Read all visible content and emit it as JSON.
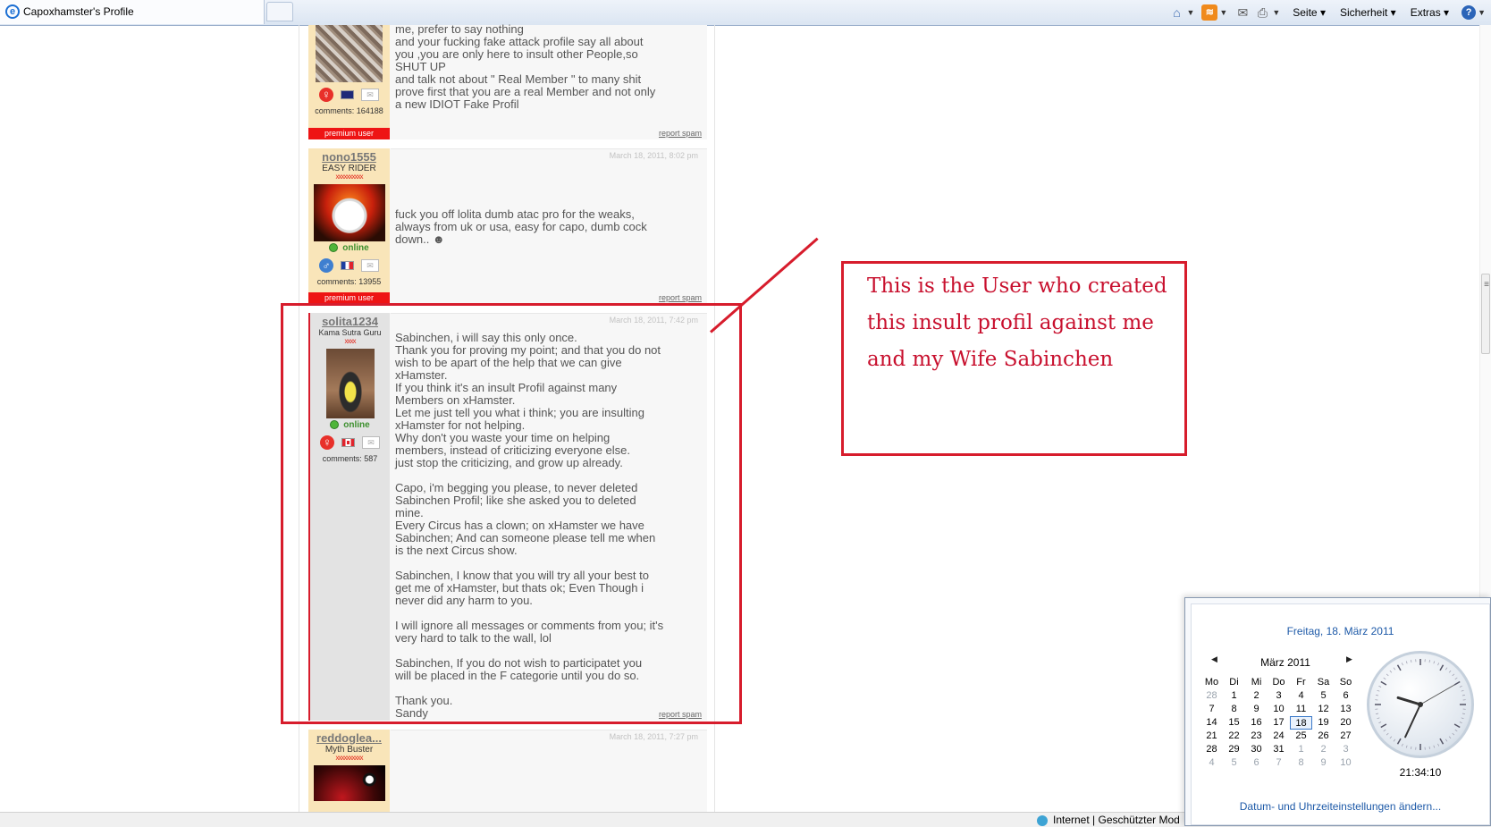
{
  "browser": {
    "tab_title": "Capoxhamster's Profile",
    "menus": [
      "Seite",
      "Sicherheit",
      "Extras"
    ]
  },
  "posts": [
    {
      "text": "me, prefer to say nothing\nand your fucking fake attack profile say all about\nyou ,you are only here to insult other People,so\nSHUT UP\nand talk not about \" Real Member \" to many shit\nprove first that you are a real Member and not only\na new IDIOT Fake Profil",
      "comments": "comments: 164188",
      "badge": "premium user",
      "report": "report spam"
    },
    {
      "username": "nono1555",
      "rank": "EASY RIDER",
      "stars": "xxxxxxxxxx",
      "status": "online",
      "date": "March 18, 2011, 8:02 pm",
      "text": "fuck you off lolita dumb atac pro for the weaks,\nalways from uk or usa, easy for capo, dumb cock\ndown.. ☻",
      "comments": "comments: 13955",
      "badge": "premium user",
      "report": "report spam"
    },
    {
      "username": "solita1234",
      "rank": "Kama Sutra Guru",
      "stars": "xxxx",
      "status": "online",
      "date": "March 18, 2011, 7:42 pm",
      "text": "Sabinchen, i will say this only once.\nThank you for proving my point; and that you do not\nwish to be apart of the help that we can give\nxHamster.\nIf you think it's an insult Profil against many\nMembers on xHamster.\nLet me just tell you what i think; you are insulting\nxHamster for not helping.\nWhy don't you waste your time on helping\nmembers, instead of criticizing everyone else.\njust stop the criticizing, and grow up already.\n\nCapo, i'm begging you please, to never deleted\nSabinchen Profil; like she asked you to deleted\nmine.\nEvery Circus has a clown; on xHamster we have\nSabinchen; And can someone please tell me when\nis the next Circus show.\n\nSabinchen, I know that you will try all your best to\nget me of xHamster, but thats ok; Even Though i\nnever did any harm to you.\n\nI will ignore all messages or comments from you; it's\nvery hard to talk to the wall, lol\n\nSabinchen, If you do not wish to participatet you\nwill be placed in the F categorie until you do so.\n\nThank you.\nSandy",
      "comments": "comments: 587",
      "report": "report spam"
    },
    {
      "username": "reddoglea...",
      "rank": "Myth Buster",
      "stars": "xxxxxxxxxx",
      "date": "March 18, 2011, 7:27 pm"
    }
  ],
  "annotation": {
    "text": "This is the User who created this insult profil against me and my Wife Sabinchen",
    "color": "#d71c2c"
  },
  "statusbar": {
    "zone": "Internet | Geschützter Mod"
  },
  "calendar": {
    "long_date": "Freitag, 18. März 2011",
    "month": "März 2011",
    "weekdays": [
      "Mo",
      "Di",
      "Mi",
      "Do",
      "Fr",
      "Sa",
      "So"
    ],
    "weeks": [
      [
        "28",
        "1",
        "2",
        "3",
        "4",
        "5",
        "6"
      ],
      [
        "7",
        "8",
        "9",
        "10",
        "11",
        "12",
        "13"
      ],
      [
        "14",
        "15",
        "16",
        "17",
        "18",
        "19",
        "20"
      ],
      [
        "21",
        "22",
        "23",
        "24",
        "25",
        "26",
        "27"
      ],
      [
        "28",
        "29",
        "30",
        "31",
        "1",
        "2",
        "3"
      ],
      [
        "4",
        "5",
        "6",
        "7",
        "8",
        "9",
        "10"
      ]
    ],
    "selected_day": "18",
    "time": "21:34:10",
    "settings_link": "Datum- und Uhrzeiteinstellungen ändern..."
  }
}
